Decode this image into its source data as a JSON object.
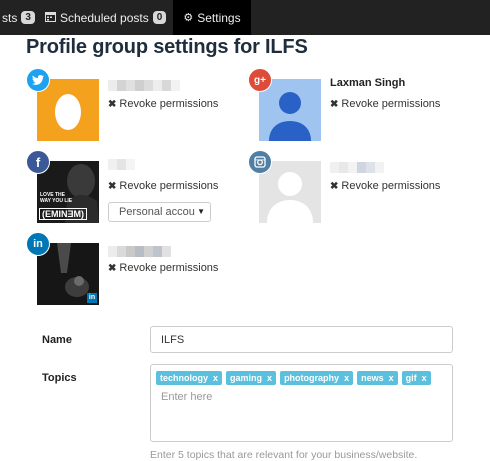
{
  "nav": {
    "tabs": [
      {
        "label": "sts",
        "badge": "3"
      },
      {
        "label": "Scheduled posts",
        "badge": "0"
      },
      {
        "label": "Settings"
      }
    ]
  },
  "title": "Profile group settings for ILFS",
  "accounts": [
    {
      "network": "twitter",
      "name": "",
      "revoke": "Revoke permissions",
      "color": "#1da1f2"
    },
    {
      "network": "google-plus",
      "name": "Laxman Singh",
      "revoke": "Revoke permissions",
      "color": "#dd4b39"
    },
    {
      "network": "facebook",
      "name": "",
      "revoke": "Revoke permissions",
      "select_value": "Personal accou",
      "color": "#3b5998"
    },
    {
      "network": "instagram",
      "name": "",
      "revoke": "Revoke permissions",
      "color": "#517fa4"
    },
    {
      "network": "linkedin",
      "name": "",
      "revoke": "Revoke permissions",
      "color": "#0077b5"
    }
  ],
  "avatar_texts": {
    "album_line1": "LOVE THE",
    "album_line2": "WAY YOU LIE",
    "album_artist": "(EMINƎM)"
  },
  "form": {
    "name_label": "Name",
    "name_value": "ILFS",
    "topics_label": "Topics",
    "topics": [
      "technology",
      "gaming",
      "photography",
      "news",
      "gif"
    ],
    "tag_remove": "x",
    "topics_placeholder": "Enter here",
    "topics_help": "Enter 5 topics that are relevant for your business/website."
  }
}
